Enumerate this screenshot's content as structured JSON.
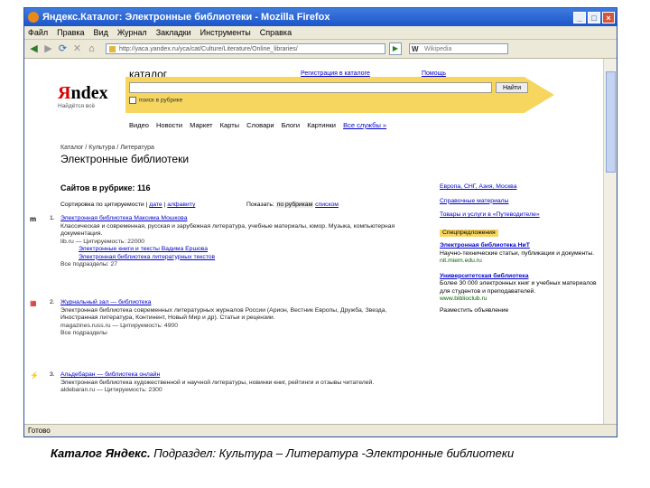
{
  "window": {
    "title": "Яндекс.Каталог: Электронные библиотеки - Mozilla Firefox",
    "status": "Готово"
  },
  "menu": [
    "Файл",
    "Правка",
    "Вид",
    "Журнал",
    "Закладки",
    "Инструменты",
    "Справка"
  ],
  "toolbar": {
    "address": "http://yaca.yandex.ru/yca/cat/Culture/Literature/Online_libraries/",
    "search_placeholder": "Wikipedia"
  },
  "header": {
    "logo_red": "Я",
    "logo_rest": "ndex",
    "logo_sub": "Найдётся всё",
    "catalog": "каталог",
    "register_link": "Регистрация в каталоге",
    "help_link": "Помощь",
    "search_button": "Найти",
    "in_section_label": "поиск в рубрике",
    "services": [
      "Видео",
      "Новости",
      "Маркет",
      "Карты",
      "Словари",
      "Блоги",
      "Картинки"
    ],
    "more_services": "Все службы »"
  },
  "page": {
    "breadcrumb": "Каталог / Культура / Литература",
    "title": "Электронные библиотеки",
    "count": "Сайтов в рубрике: 116",
    "sort_label": "Сортировка по",
    "sort_current": "цитируемости",
    "sort_date": "дате",
    "sort_alpha": "алфавиту",
    "show_label": "Показать:",
    "show_tag": "по рубрикам",
    "show_list": "списком"
  },
  "results": [
    {
      "num": "1.",
      "title": "Электронная библиотека Максима Мошкова",
      "desc": "Классическая и современная, русская и зарубежная литература, учебные материалы, юмор. Музыка, компьютерная документация.",
      "meta": "lib.ru — Цитируемость: 22000",
      "subs": [
        "Электронные книги и тексты Вадима Ершова",
        "Электронная библиотека литературных текстов"
      ],
      "sections": "Все подразделы: 27"
    },
    {
      "num": "2.",
      "title": "Журнальный зал — библиотека",
      "desc": "Электронная библиотека современных литературных журналов России (Арион, Вестник Европы, Дружба, Звезда, Иностранная литература, Континент, Новый Мир и др). Статьи и рецензии.",
      "meta": "magazines.russ.ru — Цитируемость: 4900",
      "sections": "Все подразделы"
    },
    {
      "num": "3.",
      "title": "Альдебаран — библиотека онлайн",
      "desc": "Электронная библиотека художественной и научной литературы, новинки книг, рейтинги и отзывы читателей.",
      "meta": "aldebaran.ru — Цитируемость: 2300"
    }
  ],
  "right": {
    "regions": "Европа, СНГ, Азия, Москва",
    "other": "Справочные материалы",
    "goods": "Товары и услуги в «Путеводителе»",
    "ad_label": "Спецпредложения",
    "ads": [
      {
        "title": "Электронная библиотека НиТ",
        "text": "Научно-технические статьи, публикации и документы.",
        "url": "nit.miem.edu.ru"
      },
      {
        "title": "Университетская библиотека",
        "text": "Более 30 000 электронных книг и учебных материалов для студентов и преподавателей.",
        "url": "www.biblioclub.ru"
      }
    ],
    "advertise": "Разместить объявление"
  },
  "caption": {
    "bold": "Каталог Яндекс.",
    "rest": " Подраздел: Культура – Литература -Электронные библиотеки"
  }
}
